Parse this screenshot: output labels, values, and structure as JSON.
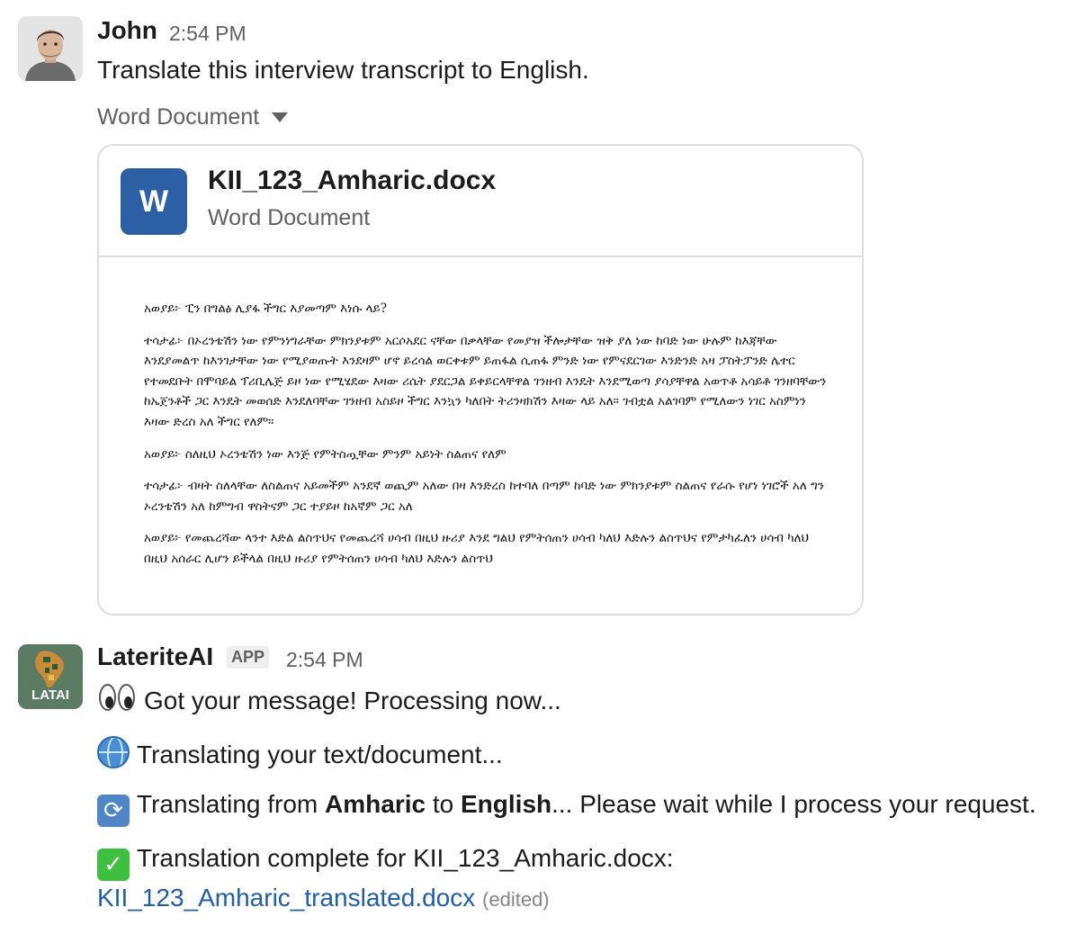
{
  "messages": [
    {
      "author": "John",
      "time": "2:54 PM",
      "text": "Translate this interview transcript to English.",
      "attachment_label": "Word Document",
      "attachment": {
        "icon_letter": "W",
        "file_name": "KII_123_Amharic.docx",
        "file_type": "Word Document",
        "preview_paragraphs": [
          "አወያይ፦ ፒን በግልፅ ሊያፋ ችግር እያመጣም እነሱ ላይ?",
          "ተሳታፊ፦ በኦረንቴሽን ነው የምንነግራቸው ምክንያቱም አርሶአደር ናቸው በቃላቸው የመያዝ ችሎታቸው ዝቅ ያለ ነው ከባድ ነው ሁሉም ከእጃቸው እንደያመልጥ ከእንገታቸው ነው የሚያወጡት እንደዛም ሆኖ ይረሳል ወርቀቱም ይጠፋል ሲጠፋ ምንድ ነው የምናደርገው እንድንድ አዛ ፓስትፓንድ ሌተር የተመደቡት በሞባይል ፕሪቢሌጅ ይዞ ነው የሚሄደው እዛው ሪሴት ያደርጋል ይቀይርላቸዋል ገንዘብ እንዴት እንደሚወጣ ያሳያቸዋል አወጥቶ አሳይቶ ገንዘባቸውን ከኤጀንቶች ጋር እንዴት መወሰድ እንደለባቸው ገንዘብ አስይዞ ችግር እንኳን ካለበት ትሪንዛክሽን እዛው ላይ አለ። ገብቷል አልገባም የሚለውን ነገር አስምነን እዛው ድረስ አለ ችግር የለም።",
          "አወያይ፦ ስለዚህ ኦረንቴሽን ነው እንጅ የምትስጧቸው ምንም አይነት ስልጠና የለም",
          "ተሳታፊ፦ ብዛት ስለላቸው ለስልጠና አይመችም አንደኛ ወጪም አለው በዛ እንድረስ ከተባለ በጣም ከባድ ነው ምክንያቱም ስልጠና የራሱ የሆነ ነገሮች አለ ግን ኦረንቴሽን አለ ከምግብ ዋስትናም ጋር ተያይዞ ከአኛም ጋር አለ",
          "አወያይ፦ የመጨረሻው ላንተ እድል ልስጥህና የመጨረሻ ሀሳብ በዚህ ዙሪያ እንደ ግልህ የምትሰጠን ሀሳብ ካለህ እድሉን ልስጥህና የምታካፈለን ሀሳብ ካለህ በዚህ አሰራር ሊሆን ይችላል በዚህ ዙሪያ የምትሰጠን ሀሳብ ካለህ እድሉን ልስጥህ"
        ]
      }
    },
    {
      "author": "LateriteAI",
      "badge": "APP",
      "time": "2:54 PM",
      "avatar_text": "LATAI",
      "lines": {
        "got_message": "Got your message! Processing now...",
        "translating": "Translating your text/document...",
        "from_prefix": "Translating from ",
        "source_lang": "Amharic",
        "to_word": " to ",
        "target_lang": "English",
        "from_suffix": "... Please wait while I process your request.",
        "complete": "Translation complete for KII_123_Amharic.docx:",
        "result_link": "KII_123_Amharic_translated.docx",
        "edited": "(edited)"
      }
    }
  ],
  "colors": {
    "word_blue": "#2c5fa3",
    "link": "#1f5fa8",
    "muted": "#616061"
  }
}
